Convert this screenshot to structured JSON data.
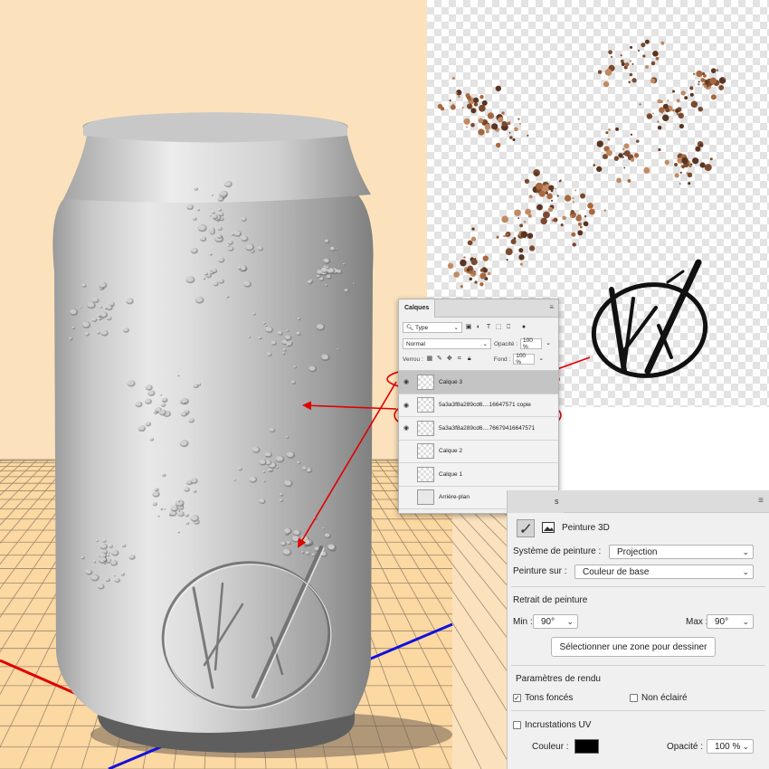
{
  "layers_panel": {
    "tab_label": "Calques",
    "filter_select": "Type",
    "blend_mode": "Normal",
    "opacity_label": "Opacité :",
    "opacity_value": "100 %",
    "lock_label": "Verrou :",
    "fill_label": "Fond :",
    "fill_value": "100 %",
    "layers": [
      {
        "name": "Calque 3",
        "visible": true,
        "selected": true
      },
      {
        "name": "5a3a3f8a289cd6....16647571 copie",
        "visible": true,
        "selected": false
      },
      {
        "name": "5a3a3f8a289cd6....76679416647571",
        "visible": true,
        "selected": false
      },
      {
        "name": "Calque 2",
        "visible": false,
        "selected": false
      },
      {
        "name": "Calque 1",
        "visible": false,
        "selected": false
      },
      {
        "name": "Arrière-plan",
        "visible": false,
        "selected": false,
        "locked": true
      }
    ]
  },
  "paint_panel": {
    "tab_label": "s",
    "title": "Peinture 3D",
    "paint_system_label": "Système de peinture :",
    "paint_system_value": "Projection",
    "paint_on_label": "Peinture sur :",
    "paint_on_value": "Couleur de base",
    "falloff_heading": "Retrait de peinture",
    "min_label": "Min :",
    "min_value": "90°",
    "max_label": "Max :",
    "max_value": "90°",
    "select_area_button": "Sélectionner une zone pour dessiner",
    "render_heading": "Paramètres de rendu",
    "dark_tones_label": "Tons foncés",
    "dark_tones_checked": true,
    "unlit_label": "Non éclairé",
    "unlit_checked": false,
    "uv_overlay_label": "Incrustations UV",
    "uv_overlay_checked": false,
    "color_label": "Couleur :",
    "color_value": "#000000",
    "opacity_label": "Opacité :",
    "opacity_value": "100 %"
  },
  "colors": {
    "backdrop": "#fbe2bd",
    "floor": "#fcd9a4",
    "annotation_arrow": "#e00000",
    "axis_red": "#e00000",
    "axis_blue": "#1111dd"
  }
}
